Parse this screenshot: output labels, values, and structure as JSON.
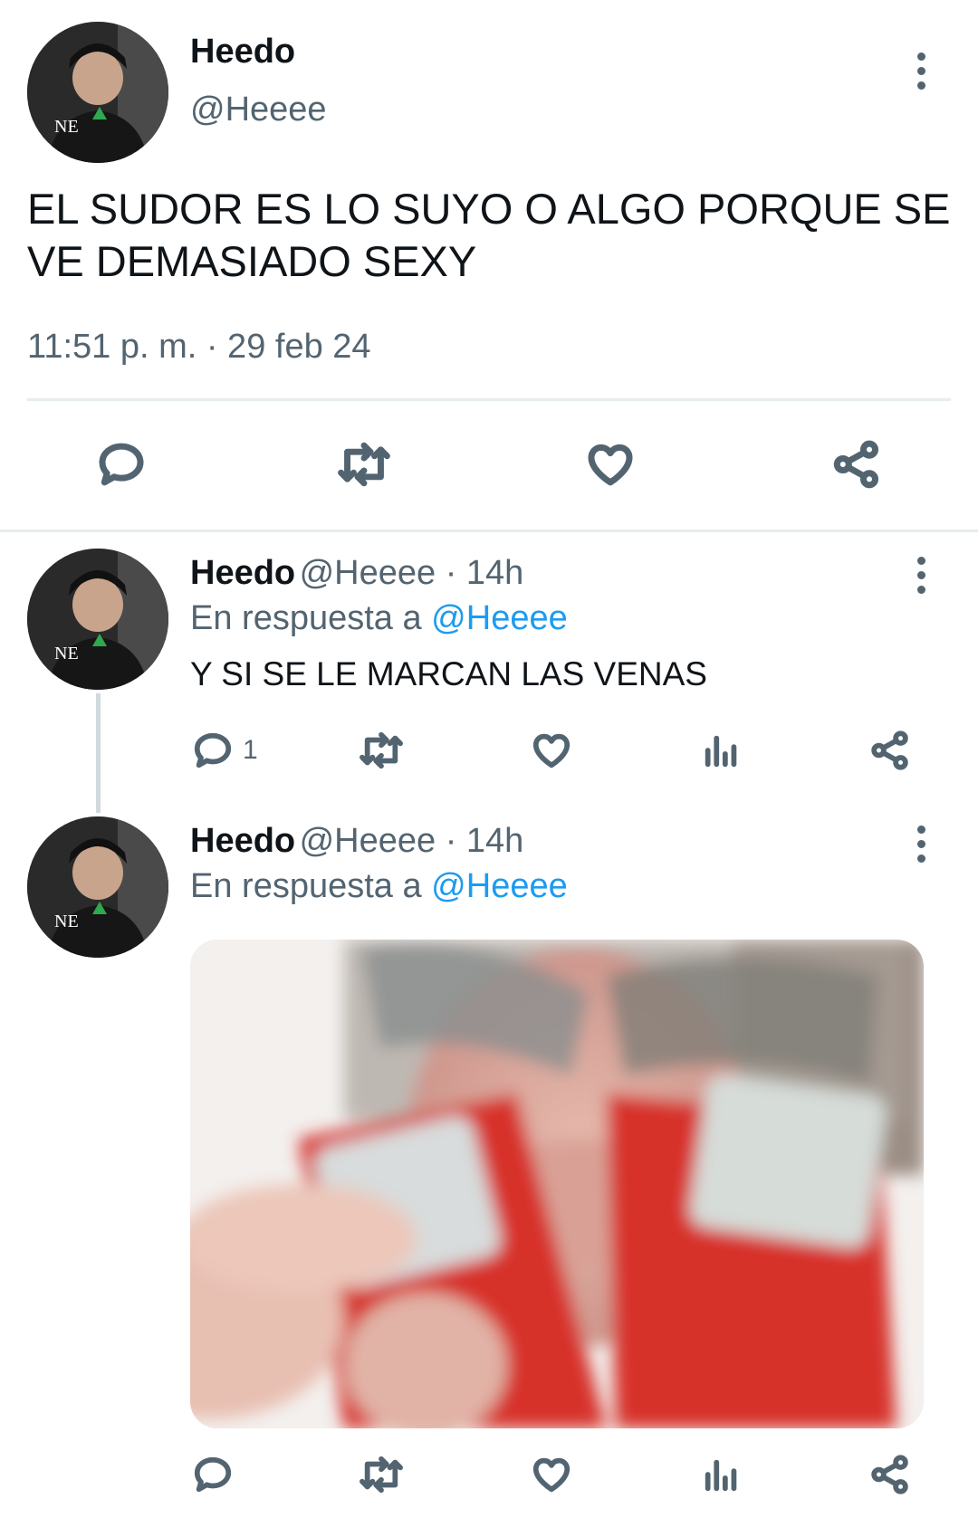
{
  "main_tweet": {
    "display_name": "Heedo",
    "handle": "@Heeee",
    "text": "EL SUDOR ES LO SUYO O ALGO PORQUE SE VE DEMASIADO SEXY",
    "timestamp": "11:51 p. m. · 29 feb 24"
  },
  "replies": [
    {
      "display_name": "Heedo",
      "meta": "@Heeee · 14h",
      "reply_prefix": "En respuesta a",
      "reply_to": "@Heeee",
      "text": "Y SI SE LE MARCAN LAS VENAS",
      "reply_count": "1"
    },
    {
      "display_name": "Heedo",
      "meta": "@Heeee · 14h",
      "reply_prefix": "En respuesta a",
      "reply_to": "@Heeee"
    }
  ],
  "icons": {
    "reply": "reply-icon",
    "retweet": "retweet-icon",
    "like": "heart-icon",
    "views": "views-icon",
    "share": "share-icon",
    "more": "more-icon"
  },
  "colors": {
    "accent": "#1d9bf0",
    "secondary_text": "#536471",
    "image_red": "#d7322c"
  }
}
